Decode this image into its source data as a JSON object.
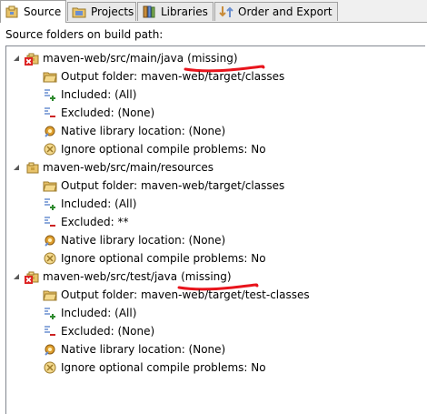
{
  "tabs": [
    {
      "label": "Source",
      "icon": "package-source-icon",
      "active": true
    },
    {
      "label": "Projects",
      "icon": "projects-folder-icon",
      "active": false
    },
    {
      "label": "Libraries",
      "icon": "libraries-icon",
      "active": false
    },
    {
      "label": "Order and Export",
      "icon": "order-export-icon",
      "active": false
    }
  ],
  "source_folders_label": "Source folders on build path:",
  "folders": [
    {
      "path": "maven-web/src/main/java",
      "missing_label": "(missing)",
      "error": true,
      "children": [
        {
          "icon": "output-folder-icon",
          "text": "Output folder: maven-web/target/classes"
        },
        {
          "icon": "included-filter-icon",
          "text": "Included: (All)"
        },
        {
          "icon": "excluded-filter-icon",
          "text": "Excluded: (None)"
        },
        {
          "icon": "native-library-icon",
          "text": "Native library location: (None)"
        },
        {
          "icon": "ignore-problems-icon",
          "text": "Ignore optional compile problems: No"
        }
      ]
    },
    {
      "path": "maven-web/src/main/resources",
      "missing_label": "",
      "error": false,
      "children": [
        {
          "icon": "output-folder-icon",
          "text": "Output folder: maven-web/target/classes"
        },
        {
          "icon": "included-filter-icon",
          "text": "Included: (All)"
        },
        {
          "icon": "excluded-filter-icon",
          "text": "Excluded: **"
        },
        {
          "icon": "native-library-icon",
          "text": "Native library location: (None)"
        },
        {
          "icon": "ignore-problems-icon",
          "text": "Ignore optional compile problems: No"
        }
      ]
    },
    {
      "path": "maven-web/src/test/java",
      "missing_label": "(missing)",
      "error": true,
      "children": [
        {
          "icon": "output-folder-icon",
          "text": "Output folder: maven-web/target/test-classes"
        },
        {
          "icon": "included-filter-icon",
          "text": "Included: (All)"
        },
        {
          "icon": "excluded-filter-icon",
          "text": "Excluded: (None)"
        },
        {
          "icon": "native-library-icon",
          "text": "Native library location: (None)"
        },
        {
          "icon": "ignore-problems-icon",
          "text": "Ignore optional compile problems: No"
        }
      ]
    }
  ],
  "colors": {
    "annotation_red": "#e8141c",
    "selection_border": "#7a9cd3",
    "folder_yellow": "#e8c36a"
  }
}
